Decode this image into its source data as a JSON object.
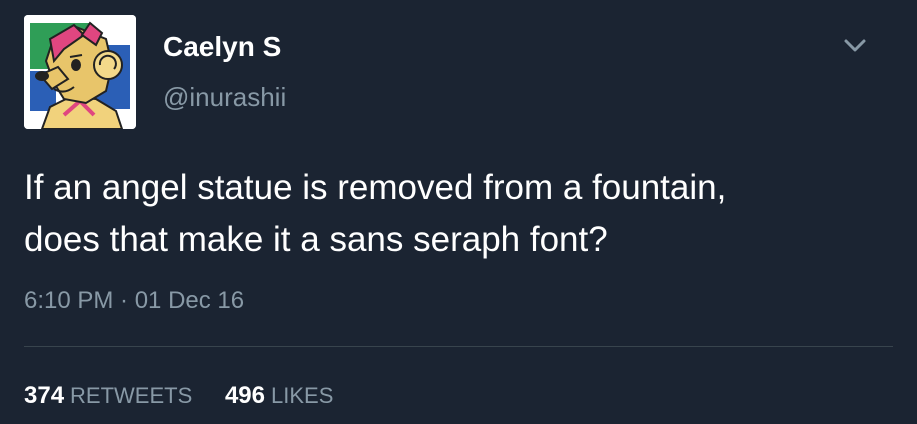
{
  "user": {
    "display_name": "Caelyn S",
    "handle": "@inurashii"
  },
  "tweet": {
    "lines": [
      "If an angel statue is removed from a fountain,",
      "does that make it a sans seraph font?"
    ],
    "timestamp": "6:10 PM · 01 Dec 16"
  },
  "stats": {
    "retweets_count": "374",
    "retweets_label": "RETWEETS",
    "likes_count": "496",
    "likes_label": "LIKES"
  },
  "icons": {
    "menu": "chevron-down-icon",
    "avatar": "cartoon-dog-avatar"
  },
  "colors": {
    "background": "#1b2432",
    "text": "#ffffff",
    "secondary_text": "#8899a6",
    "divider": "#38444d"
  }
}
